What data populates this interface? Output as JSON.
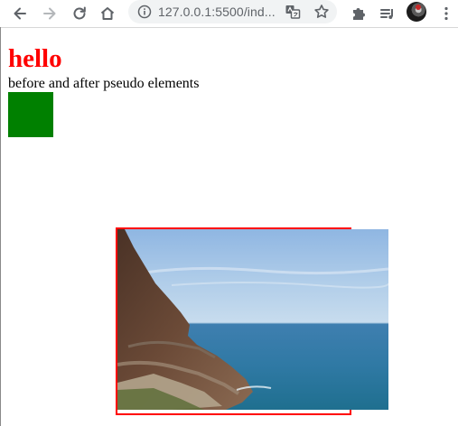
{
  "browser": {
    "url": "127.0.0.1:5500/ind...",
    "icons": [
      "back-icon",
      "forward-icon",
      "reload-icon",
      "home-icon",
      "site-info-icon",
      "translate-icon",
      "bookmark-star-icon",
      "extensions-icon",
      "reading-list-icon",
      "profile-avatar",
      "menu-icon"
    ]
  },
  "page": {
    "heading": "hello",
    "subtext": "before and after pseudo elements"
  },
  "colors": {
    "heading": "#ff0000",
    "box": "#008000",
    "frame_border": "#ff0000"
  }
}
